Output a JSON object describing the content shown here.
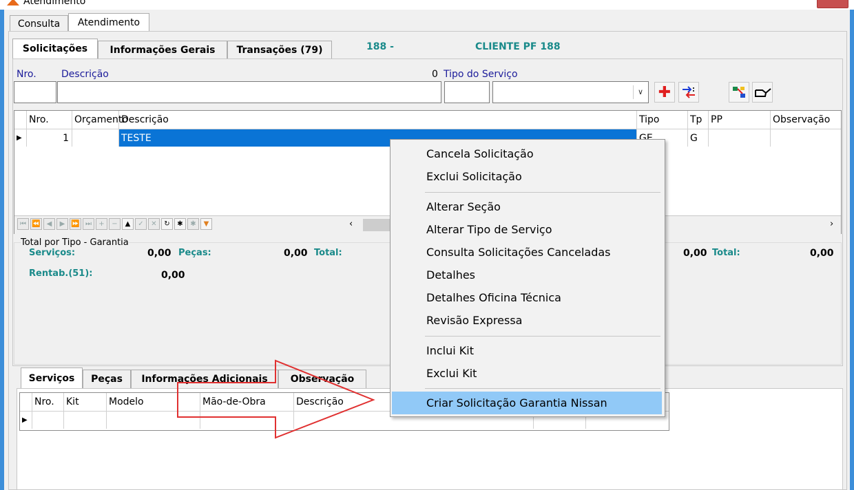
{
  "window": {
    "title": "Atendimento"
  },
  "top_tabs": [
    "Consulta",
    "Atendimento"
  ],
  "sub_tabs": [
    "Solicitações",
    "Informações Gerais",
    "Transações (79)"
  ],
  "client": {
    "code": "188 -",
    "name": "CLIENTE PF 188"
  },
  "form": {
    "nro_label": "Nro.",
    "descricao_label": "Descrição",
    "zero_value": "0",
    "tipo_servico_label": "Tipo do Serviço"
  },
  "grid": {
    "columns": [
      "Nro.",
      "Orçamento",
      "Descrição",
      "Tipo",
      "Tp",
      "PP",
      "Observação"
    ],
    "rows": [
      {
        "nro": "1",
        "orcamento": "",
        "descricao": "TESTE",
        "tipo": "GE",
        "tp": "G",
        "pp": "",
        "observacao": ""
      }
    ]
  },
  "totals": {
    "group_title": "Total por Tipo - Garantia",
    "servicos_label": "Serviços:",
    "servicos_value": "0,00",
    "pecas_label": "Peças:",
    "pecas_value": "0,00",
    "total_label": "Total:",
    "right_value": "0,00",
    "right_total_label": "Total:",
    "right_total_value": "0,00",
    "rentab_label": "Rentab.(51):",
    "rentab_value": "0,00"
  },
  "lower_tabs": [
    "Serviços",
    "Peças",
    "Informações Adicionais",
    "Observação"
  ],
  "lower_grid": {
    "columns": [
      "Nro.",
      "Kit",
      "Modelo",
      "Mão-de-Obra",
      "Descrição"
    ]
  },
  "context_menu": {
    "groups": [
      [
        "Cancela Solicitação",
        "Exclui Solicitação"
      ],
      [
        "Alterar Seção",
        "Alterar Tipo de Serviço",
        "Consulta Solicitações Canceladas",
        "Detalhes",
        "Detalhes Oficina Técnica",
        "Revisão Expressa"
      ],
      [
        "Inclui Kit",
        "Exclui Kit"
      ],
      [
        "Criar Solicitação Garantia Nissan"
      ]
    ],
    "highlighted": "Criar Solicitação Garantia Nissan"
  },
  "colors": {
    "selection": "#0a74d6",
    "menu_highlight": "#91c9f7",
    "teal_text": "#1a8a8a",
    "label_blue": "#1b1b9a",
    "arrow": "#e03030"
  }
}
